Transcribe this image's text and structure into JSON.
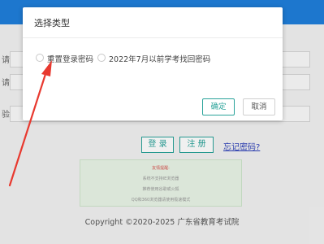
{
  "background": {
    "form_labels": [
      "请",
      "请",
      "验"
    ],
    "buttons": {
      "login": "登 录",
      "register": "注 册"
    },
    "forgot_link": "忘记密码?",
    "notice": {
      "title": "友情提醒:",
      "lines": [
        "系统不支持IE浏览器",
        "推荐使用谷歌或火狐",
        "QQ和360浏览器请使用极速模式"
      ]
    },
    "copyright": "Copyright ©2020-2025 广东省教育考试院"
  },
  "dialog": {
    "title": "选择类型",
    "options": [
      {
        "label": "重置登录密码",
        "selected": false
      },
      {
        "label": "2022年7月以前学考找回密码",
        "selected": false
      }
    ],
    "confirm_label": "确定",
    "cancel_label": "取消"
  },
  "colors": {
    "top_bar": "#1f7fdb",
    "accent": "#2aa39a",
    "link": "#2c3fb8",
    "annotation_arrow": "#e8392f"
  }
}
